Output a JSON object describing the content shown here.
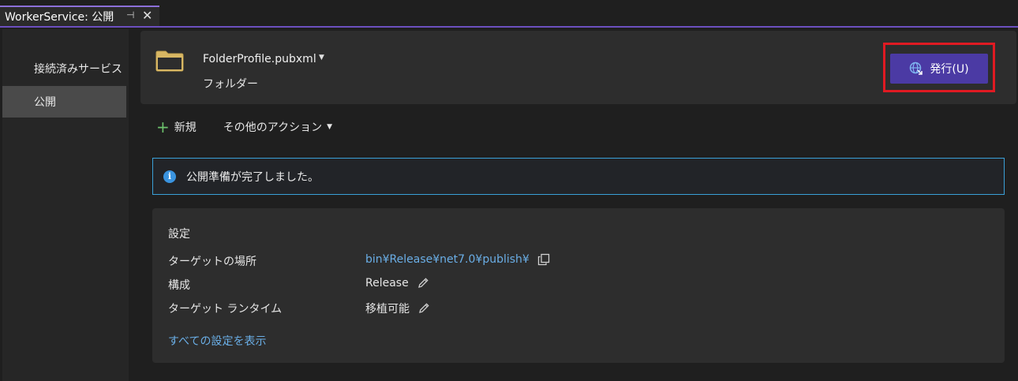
{
  "tab": {
    "title": "WorkerService: 公開",
    "pin_glyph": "⊣",
    "close_glyph": "✕"
  },
  "sidebar": {
    "items": [
      {
        "label": "接続済みサービス",
        "selected": false
      },
      {
        "label": "公開",
        "selected": true
      }
    ]
  },
  "profile": {
    "name": "FolderProfile.pubxml",
    "type": "フォルダー",
    "icon": "folder-icon",
    "publish_button_label": "発行(U)",
    "publish_icon": "globe-icon",
    "highlight_color": "#e01a22"
  },
  "actions": {
    "new_label": "新規",
    "more_label": "その他のアクション"
  },
  "info": {
    "message": "公開準備が完了しました。",
    "icon": "info-icon"
  },
  "settings": {
    "title": "設定",
    "rows": [
      {
        "label": "ターゲットの場所",
        "value": "bin¥Release¥net7.0¥publish¥",
        "action_icon": "copy-icon"
      },
      {
        "label": "構成",
        "value": "Release",
        "action_icon": "pencil-icon"
      },
      {
        "label": "ターゲット ランタイム",
        "value": "移植可能",
        "action_icon": "pencil-icon"
      }
    ],
    "show_all_label": "すべての設定を表示"
  },
  "colors": {
    "accent": "#4b3aa4",
    "tab_underline": "#6c4fbf",
    "link": "#6aaee6",
    "info_border": "#3aa0d8"
  }
}
